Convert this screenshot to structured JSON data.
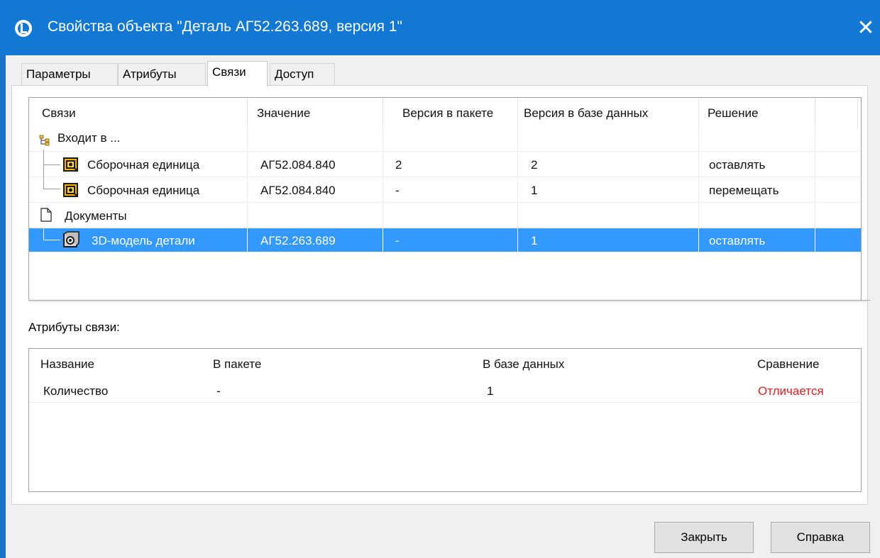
{
  "window": {
    "title": "Свойства объекта \"Деталь АГ52.263.689, версия 1\"",
    "close_glyph": "✕",
    "accent_color": "#1378d3"
  },
  "tabs": [
    {
      "label": "Параметры",
      "active": false
    },
    {
      "label": "Атрибуты",
      "active": false
    },
    {
      "label": "Связи",
      "active": true
    },
    {
      "label": "Доступ",
      "active": false
    }
  ],
  "links_grid": {
    "columns": [
      "Связи",
      "Значение",
      "Версия в пакете",
      "Версия в базе данных",
      "Решение"
    ],
    "rows": [
      {
        "name": "Входит в ...",
        "value": "",
        "pkg": "",
        "db": "",
        "decision": "",
        "icon": "hierarchy-icon",
        "level": 0
      },
      {
        "name": "Сборочная единица",
        "value": "АГ52.084.840",
        "pkg": "2",
        "db": "2",
        "decision": "оставлять",
        "icon": "assembly-icon",
        "level": 1
      },
      {
        "name": "Сборочная единица",
        "value": "АГ52.084.840",
        "pkg": "-",
        "db": "1",
        "decision": "перемещать",
        "icon": "assembly-icon",
        "level": 1
      },
      {
        "name": "Документы",
        "value": "",
        "pkg": "",
        "db": "",
        "decision": "",
        "icon": "document-icon",
        "level": 0
      },
      {
        "name": "3D-модель детали",
        "value": "АГ52.263.689",
        "pkg": "-",
        "db": "1",
        "decision": "оставлять",
        "icon": "3d-model-icon",
        "level": 1,
        "selected": true
      }
    ]
  },
  "link_attributes": {
    "label": "Атрибуты связи:",
    "columns": [
      "Название",
      "В пакете",
      "В базе данных",
      "Сравнение"
    ],
    "rows": [
      {
        "name": "Количество",
        "pkg": "-",
        "db": "1",
        "compare": "Отличается"
      }
    ],
    "diff_color": "#e02020"
  },
  "buttons": {
    "close": "Закрыть",
    "help": "Справка"
  },
  "selection_color": "#3399ff"
}
